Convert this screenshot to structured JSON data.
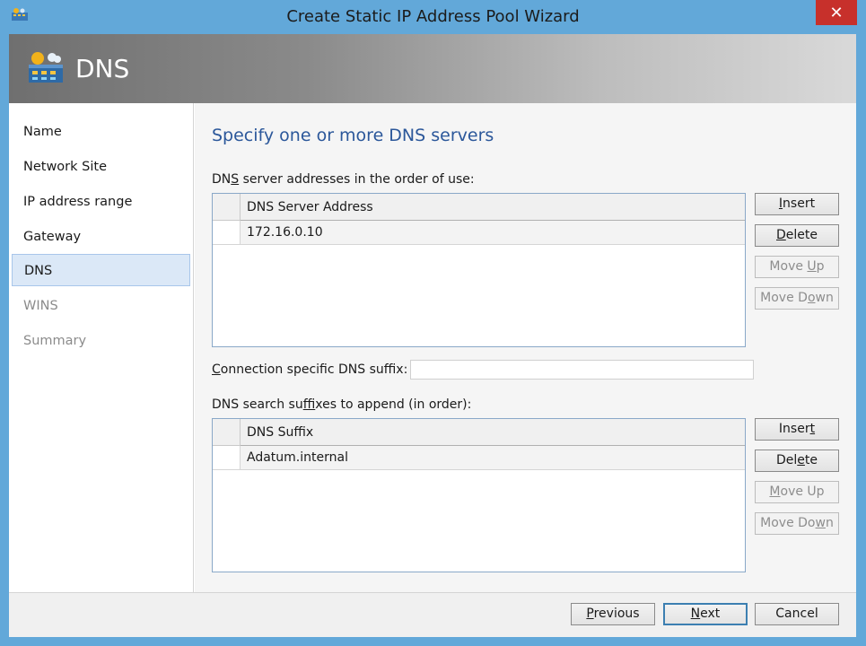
{
  "window": {
    "title": "Create Static IP Address Pool Wizard",
    "close_glyph": "✕",
    "icon": "network-pool-icon"
  },
  "banner": {
    "title": "DNS",
    "icon": "network-pool-icon"
  },
  "nav": {
    "items": [
      {
        "label": "Name",
        "state": "normal"
      },
      {
        "label": "Network Site",
        "state": "normal"
      },
      {
        "label": "IP address range",
        "state": "normal"
      },
      {
        "label": "Gateway",
        "state": "normal"
      },
      {
        "label": "DNS",
        "state": "selected"
      },
      {
        "label": "WINS",
        "state": "disabled"
      },
      {
        "label": "Summary",
        "state": "disabled"
      }
    ]
  },
  "main": {
    "heading": "Specify one or more DNS servers",
    "dns_servers": {
      "label_pre": "DN",
      "label_accel": "S",
      "label_post": " server addresses in the order of use:",
      "column_header": "DNS Server Address",
      "rows": [
        "172.16.0.10"
      ],
      "buttons": {
        "insert": {
          "pre": "",
          "accel": "I",
          "post": "nsert"
        },
        "delete": {
          "pre": "",
          "accel": "D",
          "post": "elete"
        },
        "move_up": {
          "pre": "Move ",
          "accel": "U",
          "post": "p"
        },
        "move_down": {
          "pre": "Move D",
          "accel": "o",
          "post": "wn"
        }
      }
    },
    "suffix": {
      "label_pre": "",
      "label_accel": "C",
      "label_post": "onnection specific DNS suffix:",
      "value": ""
    },
    "search_suffixes": {
      "label_pre": "DNS search su",
      "label_accel": "f",
      "label_post": "fixes to append (in order):",
      "column_header": "DNS Suffix",
      "rows": [
        "Adatum.internal"
      ],
      "buttons": {
        "insert": {
          "pre": "Inser",
          "accel": "t",
          "post": ""
        },
        "delete": {
          "pre": "Del",
          "accel": "e",
          "post": "te"
        },
        "move_up": {
          "pre": "",
          "accel": "M",
          "post": "ove Up"
        },
        "move_down": {
          "pre": "Move Do",
          "accel": "w",
          "post": "n"
        }
      }
    }
  },
  "footer": {
    "previous": {
      "pre": "",
      "accel": "P",
      "post": "revious"
    },
    "next": {
      "pre": "",
      "accel": "N",
      "post": "ext"
    },
    "cancel": {
      "label": "Cancel"
    }
  },
  "colors": {
    "title_bar": "#62a8d9",
    "close_button": "#c7302b",
    "heading": "#2b579a",
    "nav_selected": "#dbe8f7"
  }
}
